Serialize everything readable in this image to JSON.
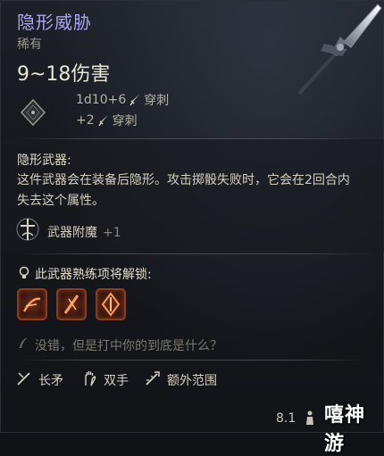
{
  "item": {
    "name": "隐形威胁",
    "rarity": "稀有",
    "damage": "9~18伤害",
    "rolls": [
      {
        "dice": "1d10+6",
        "type": "穿刺"
      },
      {
        "dice": "+2",
        "type": "穿刺"
      }
    ]
  },
  "description": {
    "title": "隐形武器:",
    "body": "这件武器会在装备后隐形。攻击掷骰失败时，它会在2回合内失去这个属性。"
  },
  "enchant": {
    "label": "武器附魔",
    "bonus": "+1"
  },
  "proficiency": {
    "label": "此武器熟练项将解锁:",
    "skills": [
      "skill-1",
      "skill-2",
      "skill-3"
    ]
  },
  "flavor_text": "没错，但是打中你的到底是什么？",
  "tags": [
    {
      "icon": "spear-icon",
      "label": "长矛"
    },
    {
      "icon": "two-hands-icon",
      "label": "双手"
    },
    {
      "icon": "reach-icon",
      "label": "额外范围"
    }
  ],
  "footer": {
    "price": "8.1"
  },
  "watermark": "嘻神游",
  "colors": {
    "name": "#a9a5ef",
    "skill_border": "#8a3a20"
  }
}
